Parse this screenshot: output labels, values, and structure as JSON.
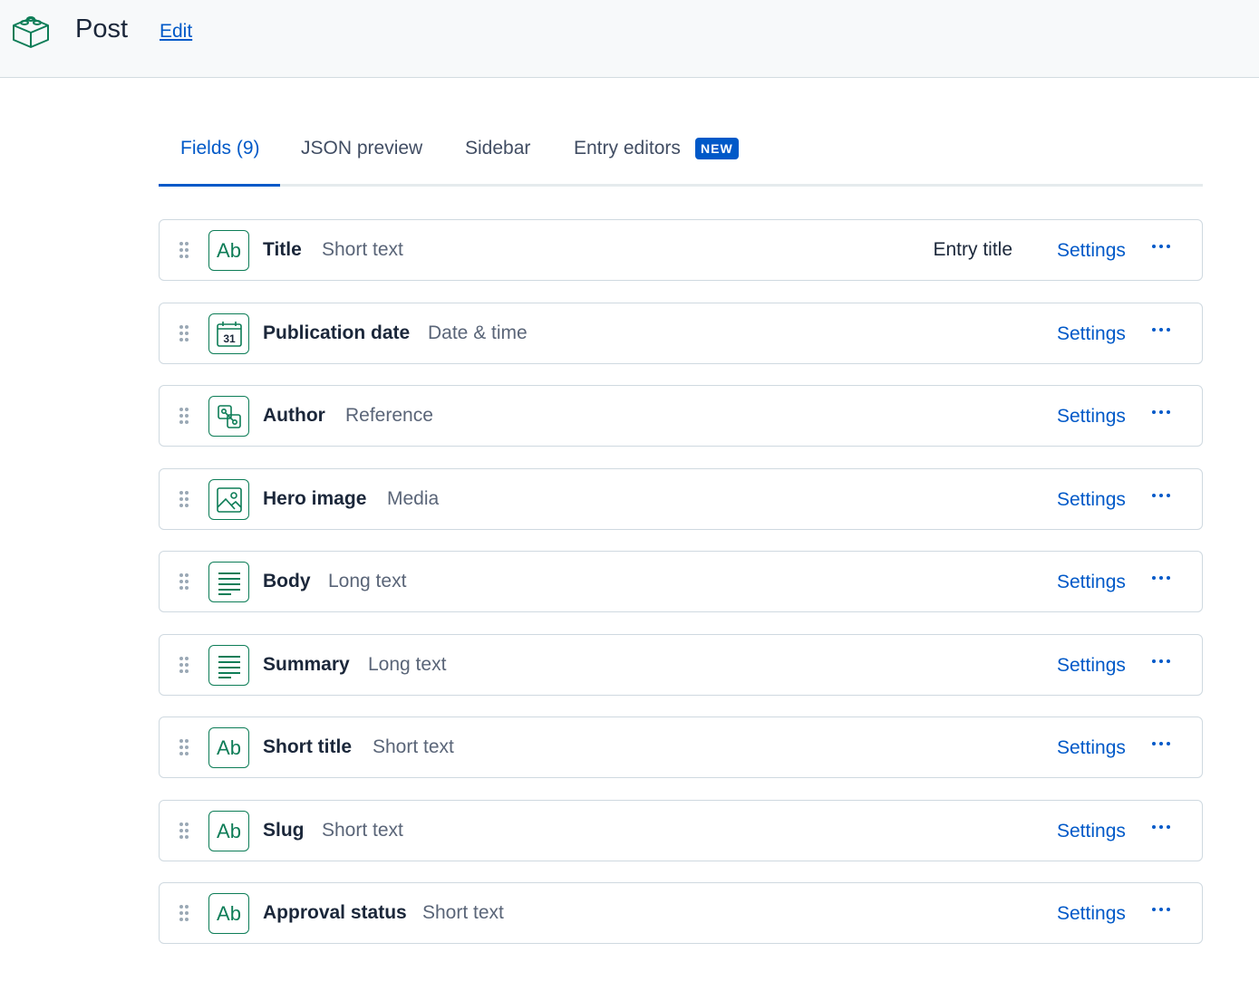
{
  "header": {
    "title": "Post",
    "edit_label": "Edit",
    "icon": "content-model-box-icon"
  },
  "tabs": [
    {
      "label": "Fields (9)",
      "active": true
    },
    {
      "label": "JSON preview",
      "active": false
    },
    {
      "label": "Sidebar",
      "active": false
    },
    {
      "label": "Entry editors",
      "active": false,
      "badge": "NEW"
    }
  ],
  "fields": [
    {
      "name": "Title",
      "type": "Short text",
      "icon": "short-text-icon",
      "entry_title": "Entry title",
      "settings": "Settings"
    },
    {
      "name": "Publication date",
      "type": "Date & time",
      "icon": "calendar-icon",
      "calendar_day": "31",
      "settings": "Settings"
    },
    {
      "name": "Author",
      "type": "Reference",
      "icon": "reference-icon",
      "settings": "Settings"
    },
    {
      "name": "Hero image",
      "type": "Media",
      "icon": "media-icon",
      "settings": "Settings"
    },
    {
      "name": "Body",
      "type": "Long text",
      "icon": "long-text-icon",
      "settings": "Settings"
    },
    {
      "name": "Summary",
      "type": "Long text",
      "icon": "long-text-icon",
      "settings": "Settings"
    },
    {
      "name": "Short title",
      "type": "Short text",
      "icon": "short-text-icon",
      "settings": "Settings"
    },
    {
      "name": "Slug",
      "type": "Short text",
      "icon": "short-text-icon",
      "settings": "Settings"
    },
    {
      "name": "Approval status",
      "type": "Short text",
      "icon": "short-text-icon",
      "settings": "Settings"
    }
  ],
  "short_text_glyph": "Ab",
  "colors": {
    "accent": "#0059c8",
    "field_icon": "#0d7d57",
    "text_primary": "#1b273a",
    "text_secondary": "#5a6578"
  }
}
